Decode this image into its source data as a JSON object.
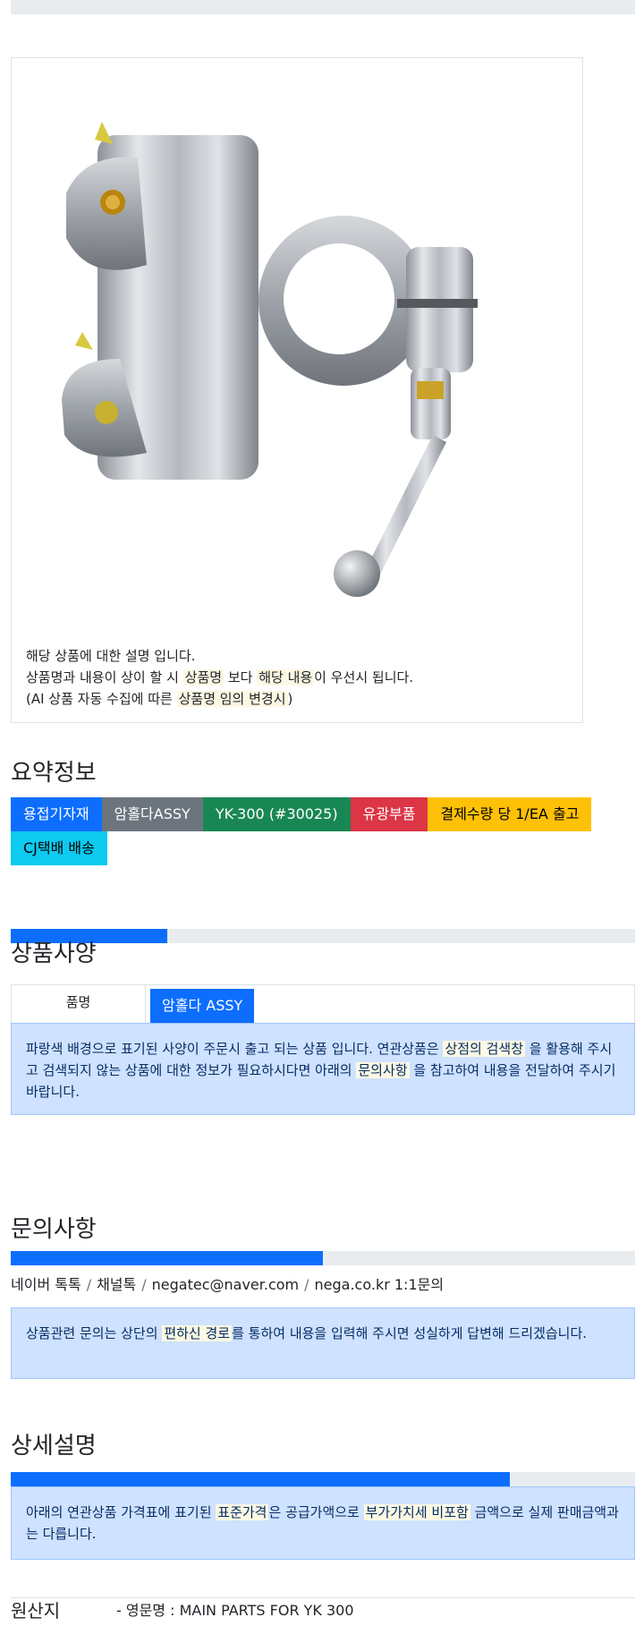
{
  "product_image": {
    "icon": "clamp-part-photo"
  },
  "image_caption": {
    "line1": "해당 상품에 대한 설명 입니다.",
    "line2_a": "상품명과 내용이 상이 할 시 ",
    "line2_mark1": "상품명",
    "line2_b": " 보다 ",
    "line2_mark2": "해당 내용",
    "line2_c": "이 우선시 됩니다.",
    "line3_a": "(AI 상품 자동 수집에 따른 ",
    "line3_mark": "상품명 임의 변경시",
    "line3_b": ")"
  },
  "summary": {
    "title": "요약정보",
    "badges": [
      {
        "label": "용접기자재",
        "color": "#0d6efd"
      },
      {
        "label": "암홀다ASSY",
        "color": "#6c757d"
      },
      {
        "label": "YK-300 (#30025)",
        "color": "#198754"
      },
      {
        "label": "유광부품",
        "color": "#dc3545"
      },
      {
        "label": "결제수량 당 1/EA 출고",
        "color": "#ffc107"
      },
      {
        "label": "CJ택배 배송",
        "color": "#0dcaf0"
      }
    ]
  },
  "spec": {
    "progress": 0.25,
    "title": "상품사양",
    "label": "품명",
    "value": "암홀다 ASSY",
    "notice_a": "파랑색 배경으로 표기된 사양이 주문시 출고 되는 상품 입니다. 연관상품은 ",
    "notice_mark1": "상점의 검색창",
    "notice_b": " 을 활용해 주시고 검색되지 않는 상품에 대한 정보가 필요하시다면 아래의 ",
    "notice_mark2": "문의사항",
    "notice_c": " 을 참고하여 내용을 전달하여 주시기 바랍니다."
  },
  "inquiry": {
    "title": "문의사항",
    "progress": 0.5,
    "contacts": [
      "네이버 톡톡",
      "채널톡",
      "negatec@naver.com",
      "nega.co.kr 1:1문의"
    ],
    "notice_a": "상품관련 문의는 상단의 ",
    "notice_mark": "편하신 경로",
    "notice_b": "를 통하여 내용을 입력해 주시면 성실하게 답변해 드리겠습니다."
  },
  "detail": {
    "title": "상세설명",
    "progress": 0.8,
    "notice_a": "아래의 연관상품 가격표에 표기된 ",
    "notice_mark1": "표준가격",
    "notice_b": "은 공급가액으로 ",
    "notice_mark2": "부가가치세 비포함",
    "notice_c": " 금액으로 실제 판매금액과는 다릅니다."
  },
  "origin": {
    "label": "원산지",
    "english_name": "- 영문명 : MAIN PARTS FOR YK 300"
  }
}
